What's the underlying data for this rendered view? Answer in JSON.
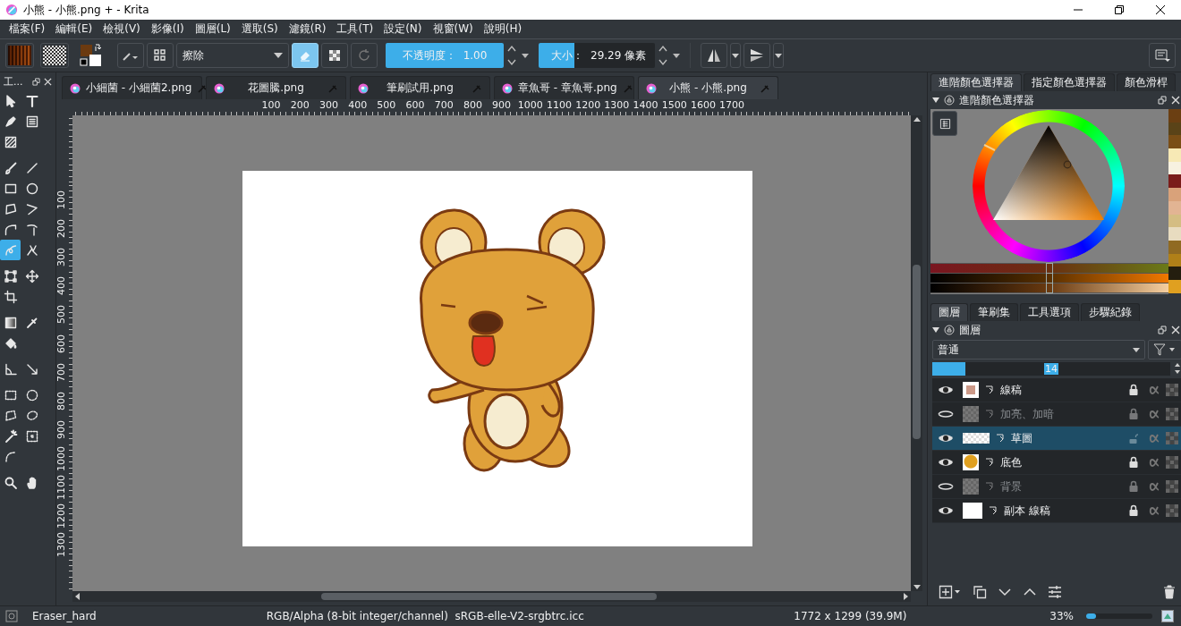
{
  "window": {
    "title": "小熊 - 小熊.png + - Krita"
  },
  "menu": [
    "檔案(F)",
    "編輯(E)",
    "檢視(V)",
    "影像(I)",
    "圖層(L)",
    "選取(S)",
    "濾鏡(R)",
    "工具(T)",
    "設定(N)",
    "視窗(W)",
    "說明(H)"
  ],
  "toolbar": {
    "preset": "擦除",
    "eraser_mode": true,
    "preserve_alpha": false,
    "opacity": {
      "label": "不透明度：",
      "value": "1.00",
      "level": 1
    },
    "size": {
      "label": "大小：",
      "value": "29.29 像素",
      "level": 0.31
    }
  },
  "toolbox": {
    "title": "工...",
    "groups": [
      {
        "tools": [
          {
            "kind": "select",
            "selected": false
          },
          {
            "kind": "text",
            "selected": false
          },
          {
            "kind": "pen",
            "selected": false
          },
          {
            "kind": "image",
            "selected": false
          },
          {
            "kind": "pattern",
            "selected": false
          }
        ]
      },
      {
        "tools": [
          {
            "kind": "brush",
            "selected": false
          },
          {
            "kind": "line",
            "selected": false
          },
          {
            "kind": "rect",
            "selected": false
          },
          {
            "kind": "ellipse",
            "selected": false
          },
          {
            "kind": "polygon",
            "selected": false
          },
          {
            "kind": "polyline",
            "selected": false
          },
          {
            "kind": "bezier",
            "selected": false
          },
          {
            "kind": "freepath",
            "selected": false
          },
          {
            "kind": "dynamic",
            "selected": true
          },
          {
            "kind": "multibrush",
            "selected": false
          }
        ]
      },
      {
        "tools": [
          {
            "kind": "transform",
            "selected": false
          },
          {
            "kind": "move",
            "selected": false
          },
          {
            "kind": "crop",
            "selected": false
          }
        ]
      },
      {
        "tools": [
          {
            "kind": "gradient",
            "selected": false
          },
          {
            "kind": "picker",
            "selected": false
          },
          {
            "kind": "fill",
            "selected": false
          }
        ]
      },
      {
        "tools": [
          {
            "kind": "measure",
            "selected": false
          },
          {
            "kind": "assistant",
            "selected": false
          }
        ]
      },
      {
        "tools": [
          {
            "kind": "rectsel",
            "selected": false
          },
          {
            "kind": "ellsel",
            "selected": false
          },
          {
            "kind": "polysel",
            "selected": false
          },
          {
            "kind": "freesel",
            "selected": false
          },
          {
            "kind": "wand",
            "selected": false
          },
          {
            "kind": "similar",
            "selected": false
          },
          {
            "kind": "beziersel",
            "selected": false
          }
        ]
      },
      {
        "tools": [
          {
            "kind": "zoom",
            "selected": false
          },
          {
            "kind": "hand",
            "selected": false
          }
        ]
      }
    ]
  },
  "document_tabs": [
    {
      "label": "小細菌 - 小細菌2.png",
      "selected": false
    },
    {
      "label": "花圖騰.png",
      "selected": false
    },
    {
      "label": "筆刷試用.png",
      "selected": false
    },
    {
      "label": "章魚哥 - 章魚哥.png",
      "selected": false
    },
    {
      "label": "小熊 - 小熊.png",
      "selected": true
    }
  ],
  "rulers": {
    "horizontal": [
      "100",
      "200",
      "300",
      "400",
      "500",
      "600",
      "700",
      "800",
      "900",
      "1000",
      "1100",
      "1200",
      "1300",
      "1400",
      "1500",
      "1600",
      "1700"
    ],
    "vertical": [
      "100",
      "200",
      "300",
      "400",
      "500",
      "600",
      "700",
      "800",
      "900",
      "1000",
      "1100",
      "1200",
      "1300"
    ]
  },
  "color_docker": {
    "tabs": [
      {
        "label": "進階顏色選擇器",
        "selected": true
      },
      {
        "label": "指定顏色選擇器",
        "selected": false
      },
      {
        "label": "顏色滑桿",
        "selected": false
      }
    ],
    "title": "進階顏色選擇器",
    "swatches": [
      {
        "color": "#6b3f12"
      },
      {
        "color": "#5a4318"
      },
      {
        "color": "#7a4e16"
      },
      {
        "color": "#f7e9b5"
      },
      {
        "color": "#f7f1e0"
      },
      {
        "color": "#7a1c1a"
      },
      {
        "color": "#d9a27a"
      },
      {
        "color": "#e2b493"
      },
      {
        "color": "#d4bd83"
      },
      {
        "color": "#e8dcc0"
      },
      {
        "color": "#906a22"
      },
      {
        "color": "#b08018"
      },
      {
        "color": "#241e0f"
      },
      {
        "color": "#e0a020"
      }
    ],
    "sliders": [
      {
        "kind": "hue",
        "level": 0.5
      },
      {
        "kind": "saturation",
        "level": 0.5
      },
      {
        "kind": "value",
        "level": 0.5
      }
    ]
  },
  "layers_docker": {
    "tabs": [
      {
        "label": "圖層",
        "selected": true
      },
      {
        "label": "筆刷集",
        "selected": false
      },
      {
        "label": "工具選項",
        "selected": false
      },
      {
        "label": "步驟紀錄",
        "selected": false
      }
    ],
    "title": "圖層",
    "blend_mode": "普通",
    "opacity": {
      "value": "14",
      "level": 0.14
    },
    "layers": [
      {
        "name": "線稿",
        "visible": true,
        "selected": false,
        "locked": true,
        "kind": "lineart"
      },
      {
        "name": "加亮、加暗",
        "visible": false,
        "selected": false,
        "locked": true,
        "kind": "gray"
      },
      {
        "name": "草圖",
        "visible": true,
        "selected": true,
        "locked": false,
        "kind": "transparent"
      },
      {
        "name": "底色",
        "visible": true,
        "selected": false,
        "locked": true,
        "kind": "bear"
      },
      {
        "name": "背景",
        "visible": false,
        "selected": false,
        "locked": true,
        "kind": "gray"
      },
      {
        "name": "副本 線稿",
        "visible": true,
        "selected": false,
        "locked": true,
        "kind": "white"
      }
    ]
  },
  "status_bar": {
    "brush": "Eraser_hard",
    "color_space": "RGB/Alpha (8-bit integer/channel)  sRGB-elle-V2-srgbtrc.icc",
    "dimensions": "1772 x 1299 (39.9M)",
    "zoom": "33%",
    "zoom_slider": {
      "level": 0.15
    }
  }
}
